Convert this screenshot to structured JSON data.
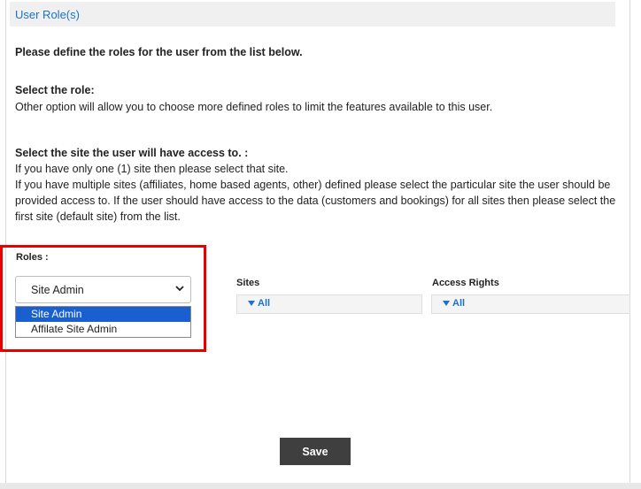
{
  "header": {
    "title": "User Role(s)"
  },
  "intro": "Please define the roles for the user from the list below.",
  "role_section": {
    "title": "Select the role:",
    "description": "Other option will allow you to choose more defined roles to limit the features available to this user."
  },
  "site_section": {
    "title": "Select the site the user will have access to. :",
    "lines": [
      "If you have only one (1) site then please select that site.",
      "If you have multiple sites (affiliates, home based agents, other) defined please select the particular site the user should be",
      "provided access to. If the user should have access to the data (customers and bookings) for all sites then please select the",
      "first site (default site) from the list."
    ]
  },
  "roles": {
    "label": "Roles :",
    "selected": "Site Admin",
    "options": [
      "Site Admin",
      "Affilate Site Admin"
    ]
  },
  "sites": {
    "label": "Sites",
    "value": "All"
  },
  "access_rights": {
    "label": "Access Rights",
    "value": "All"
  },
  "save_label": "Save",
  "colors": {
    "accent_link": "#1a73c8",
    "highlight_border": "#e60000",
    "selected_option_bg": "#1a5fd0",
    "save_button_bg": "#3f3f3f"
  }
}
